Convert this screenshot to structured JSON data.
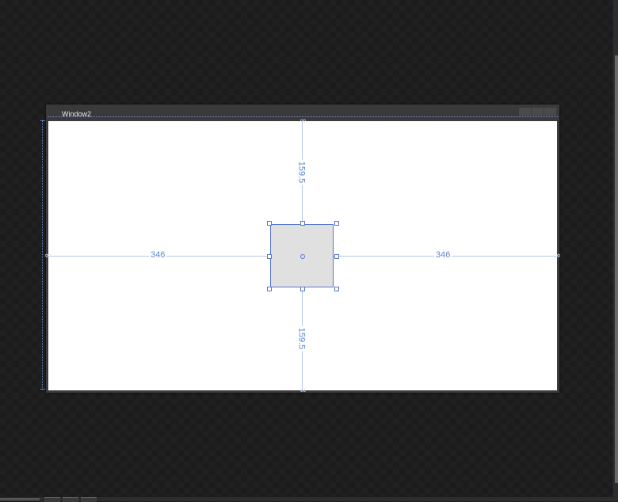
{
  "window": {
    "title": "Window2"
  },
  "measurements": {
    "left": "346",
    "right": "346",
    "top": "159.5",
    "bottom": "159.5"
  },
  "colors": {
    "guide": "#5b86d0",
    "selection": "#5577cc",
    "rect_fill": "#e0e0e0",
    "canvas_bg": "#1f1f1f"
  },
  "icons": [
    "link-icon",
    "anchor-icon"
  ]
}
